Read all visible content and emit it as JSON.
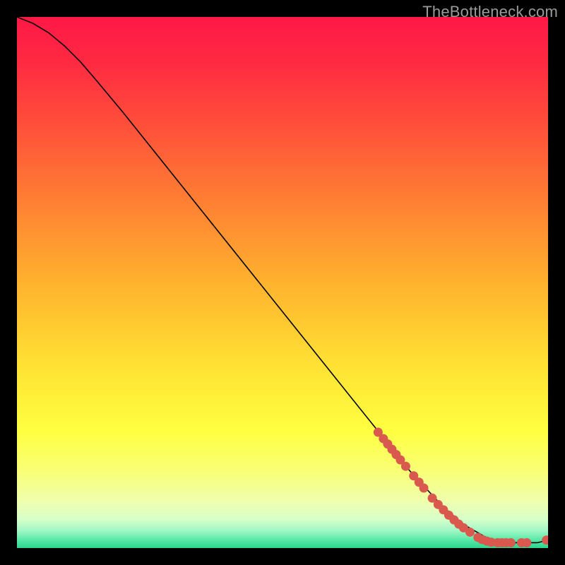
{
  "watermark": "TheBottleneck.com",
  "chart_data": {
    "type": "line",
    "title": "",
    "xlabel": "",
    "ylabel": "",
    "xlim": [
      0,
      100
    ],
    "ylim": [
      0,
      100
    ],
    "background_gradient_stops": [
      {
        "pos": 0.0,
        "color": "#ff1846"
      },
      {
        "pos": 0.08,
        "color": "#ff2842"
      },
      {
        "pos": 0.2,
        "color": "#ff4e3a"
      },
      {
        "pos": 0.35,
        "color": "#ff8033"
      },
      {
        "pos": 0.5,
        "color": "#ffb22e"
      },
      {
        "pos": 0.65,
        "color": "#ffe033"
      },
      {
        "pos": 0.78,
        "color": "#ffff40"
      },
      {
        "pos": 0.86,
        "color": "#f8ff7a"
      },
      {
        "pos": 0.915,
        "color": "#eeffb0"
      },
      {
        "pos": 0.945,
        "color": "#d8ffc8"
      },
      {
        "pos": 0.965,
        "color": "#a8f8c8"
      },
      {
        "pos": 0.985,
        "color": "#58e8a8"
      },
      {
        "pos": 1.0,
        "color": "#2cd58e"
      }
    ],
    "series": [
      {
        "name": "curve",
        "type": "line",
        "color": "#000000",
        "x": [
          0,
          3,
          6,
          9,
          12,
          15,
          20,
          30,
          40,
          50,
          60,
          68,
          74,
          80,
          84,
          88,
          90,
          92,
          94,
          96,
          98,
          100
        ],
        "y": [
          100,
          98.8,
          97.0,
          94.5,
          91.5,
          88.0,
          82.0,
          69.5,
          57.0,
          44.5,
          32.0,
          22.0,
          14.5,
          8.0,
          4.5,
          2.2,
          1.3,
          1.0,
          1.0,
          1.0,
          1.0,
          1.5
        ]
      },
      {
        "name": "points",
        "type": "scatter",
        "color": "#d9594f",
        "marker_radius": 6.5,
        "x": [
          68.0,
          69.0,
          69.8,
          70.6,
          71.4,
          72.2,
          73.2,
          74.7,
          75.7,
          76.6,
          78.2,
          79.3,
          80.3,
          81.3,
          82.3,
          83.2,
          84.1,
          85.3,
          86.8,
          87.6,
          88.5,
          89.3,
          90.5,
          91.3,
          92.1,
          93.0,
          95.0,
          96.0,
          99.7
        ],
        "y": [
          21.8,
          20.6,
          19.6,
          18.6,
          17.6,
          16.6,
          15.4,
          13.6,
          12.4,
          11.3,
          9.4,
          8.2,
          7.2,
          6.2,
          5.3,
          4.5,
          3.8,
          3.0,
          2.0,
          1.6,
          1.3,
          1.1,
          1.0,
          1.0,
          1.0,
          1.0,
          1.0,
          1.0,
          1.5
        ]
      }
    ]
  }
}
